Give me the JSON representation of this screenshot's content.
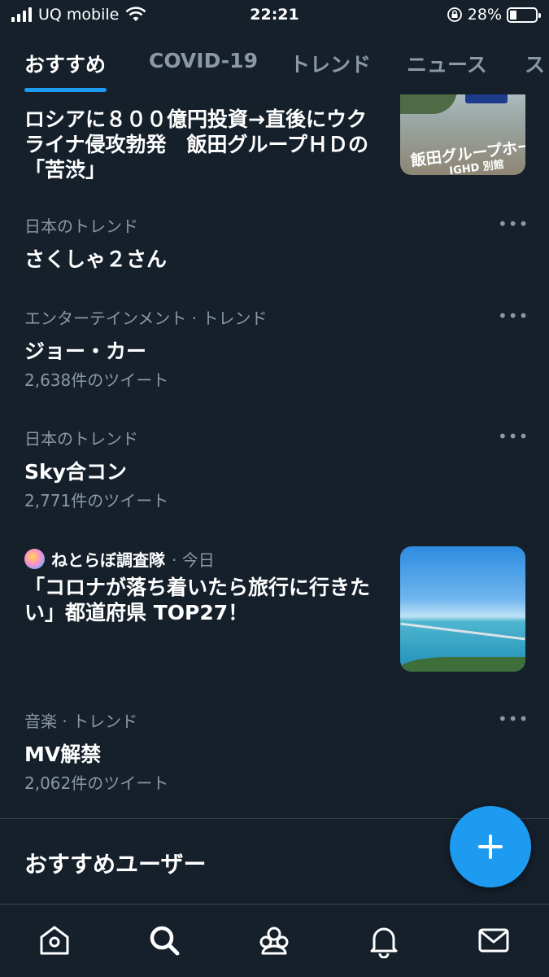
{
  "status_bar": {
    "carrier": "UQ mobile",
    "time": "22:21",
    "battery": "28%"
  },
  "tabs": [
    {
      "label": "おすすめ",
      "active": true
    },
    {
      "label": "COVID-19",
      "active": false
    },
    {
      "label": "トレンド",
      "active": false
    },
    {
      "label": "ニュース",
      "active": false
    },
    {
      "label": "ス",
      "active": false
    }
  ],
  "news_partial": {
    "headline": "ロシアに８００億円投資→直後にウクライナ侵攻勃発　飯田グループＨＤの「苦渋」",
    "thumb_text_main": "飯田グループホールディングス",
    "thumb_text_sub": "IGHD 別館"
  },
  "trends": [
    {
      "context": "日本のトレンド",
      "name": "さくしゃ２さん",
      "count": ""
    },
    {
      "context": "エンターテインメント · トレンド",
      "name": "ジョー・カー",
      "count": "2,638件のツイート"
    },
    {
      "context": "日本のトレンド",
      "name": "Sky合コン",
      "count": "2,771件のツイート"
    },
    {
      "context": "音楽 · トレンド",
      "name": "MV解禁",
      "count": "2,062件のツイート"
    }
  ],
  "article": {
    "source": "ねとらぼ調査隊",
    "time": "· 今日",
    "headline": "「コロナが落ち着いたら旅行に行きたい」都道府県 TOP27！"
  },
  "more_label": "•••",
  "section_title": "おすすめユーザー",
  "colors": {
    "background": "#15202b",
    "accent": "#1d9bf0",
    "secondary_text": "#8b98a5",
    "divider": "#38444d"
  },
  "nav": [
    "home-icon",
    "search-icon",
    "communities-icon",
    "notifications-icon",
    "messages-icon"
  ]
}
